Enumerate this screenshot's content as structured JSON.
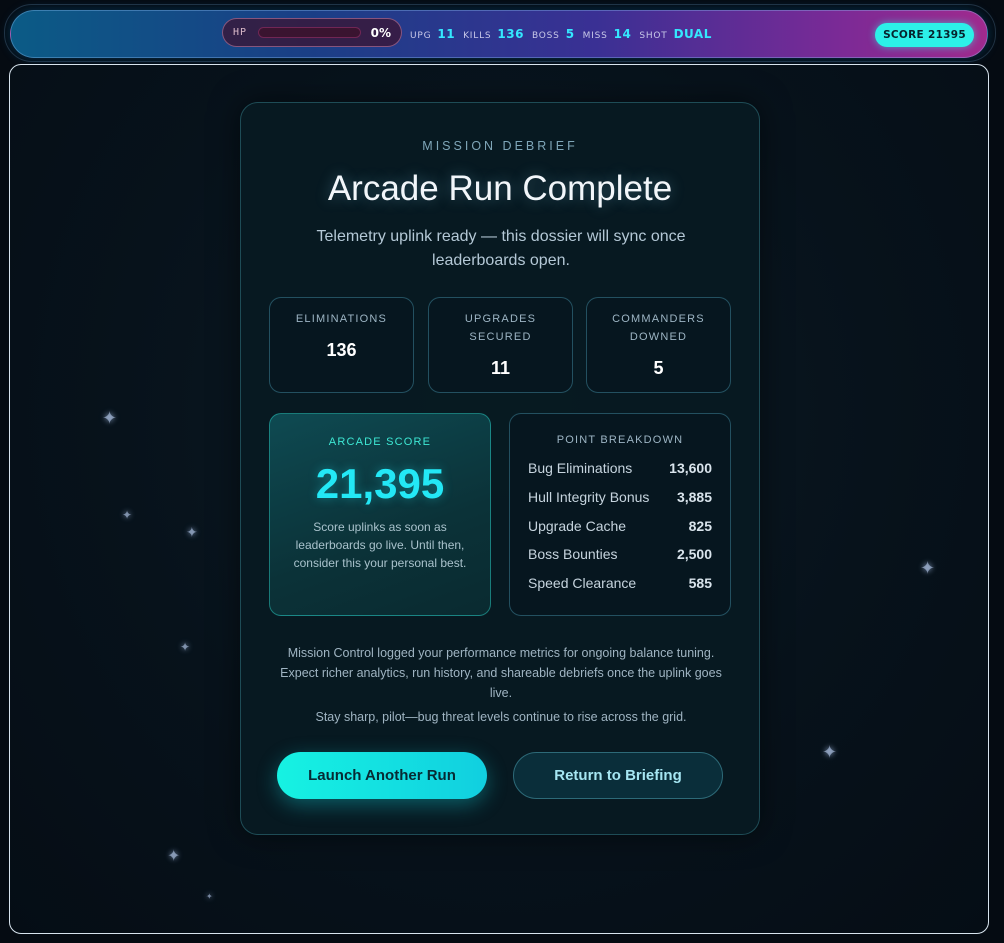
{
  "hud": {
    "hp_label": "HP",
    "hp_value": "0%",
    "hp_fraction": 0,
    "stats": [
      {
        "label": "UPG",
        "value": "11"
      },
      {
        "label": "KILLS",
        "value": "136"
      },
      {
        "label": "BOSS",
        "value": "5"
      },
      {
        "label": "MISS",
        "value": "14"
      },
      {
        "label": "SHOT",
        "value": "DUAL"
      }
    ],
    "score": "SCORE 21395"
  },
  "debrief": {
    "eyebrow": "MISSION DEBRIEF",
    "title": "Arcade Run Complete",
    "subtitle": "Telemetry uplink ready — this dossier will sync once leaderboards open.",
    "stat_cards": [
      {
        "label": "ELIMINATIONS",
        "value": "136"
      },
      {
        "label": "UPGRADES SECURED",
        "value": "11"
      },
      {
        "label": "COMMANDERS DOWNED",
        "value": "5"
      }
    ],
    "score_label": "ARCADE SCORE",
    "score_value": "21,395",
    "score_note": "Score uplinks as soon as leaderboards go live. Until then, consider this your personal best.",
    "breakdown_label": "POINT BREAKDOWN",
    "breakdown": [
      {
        "name": "Bug Eliminations",
        "points": "13,600"
      },
      {
        "name": "Hull Integrity Bonus",
        "points": "3,885"
      },
      {
        "name": "Upgrade Cache",
        "points": "825"
      },
      {
        "name": "Boss Bounties",
        "points": "2,500"
      },
      {
        "name": "Speed Clearance",
        "points": "585"
      }
    ],
    "paragraph_1": "Mission Control logged your performance metrics for ongoing balance tuning. Expect richer analytics, run history, and shareable debriefs once the uplink goes live.",
    "paragraph_2": "Stay sharp, pilot—bug threat levels continue to rise across the grid.",
    "primary_button": "Launch Another Run",
    "secondary_button": "Return to Briefing"
  }
}
